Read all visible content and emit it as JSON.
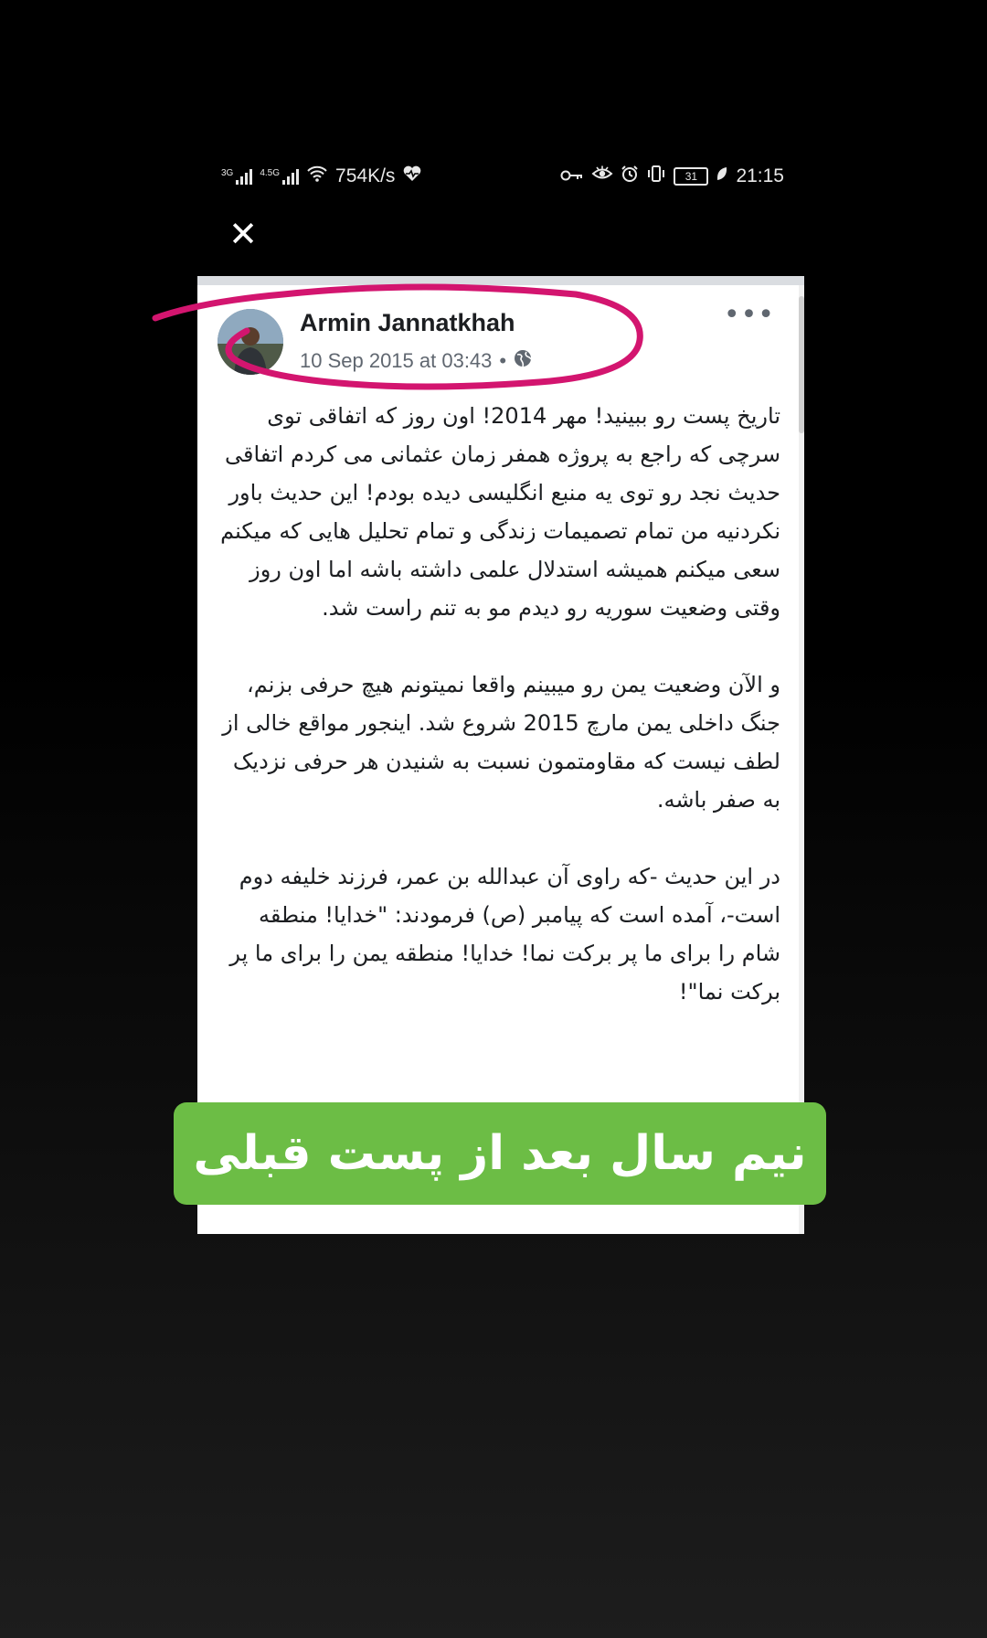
{
  "status_bar": {
    "network_1": "3G",
    "network_2": "4.5G",
    "speed": "754K/s",
    "battery": "31",
    "time": "21:15"
  },
  "icons": {
    "close": "close-icon",
    "more": "more-options-icon",
    "audience": "globe-icon",
    "wifi": "wifi-icon",
    "heart": "heart-rate-icon",
    "key": "key-icon",
    "eye": "eye-icon",
    "alarm": "alarm-icon",
    "vibrate": "vibrate-icon",
    "leaf": "leaf-icon"
  },
  "post": {
    "author": "Armin Jannatkhah",
    "timestamp": "10 Sep 2015 at 03:43",
    "separator": "•",
    "paragraphs": [
      "تاریخ پست رو ببینید! مهر 2014! اون روز که اتفاقی توی سرچی که راجع به پروژه همفر زمان عثمانی می کردم اتفاقی حدیث نجد رو توی یه منبع انگلیسی دیده بودم! این حدیث باور نکردنیه من تمام تصمیمات زندگی و تمام تحلیل هایی که میکنم سعی میکنم همیشه استدلال علمی داشته باشه اما اون روز وقتی وضعیت سوریه رو دیدم مو به تنم راست شد.",
      "و الآن وضعیت یمن رو میبینم واقعا نمیتونم هیچ حرفی بزنم، جنگ داخلی یمن مارچ 2015 شروع شد. اینجور مواقع خالی از لطف نیست که مقاومتمون نسبت به شنیدن هر حرفی نزدیک به صفر باشه.",
      "در این حدیث -که راوی آن عبدالله بن عمر، فرزند خلیفه دوم است-، آمده است که پیامبر (ص) فرمودند: \"خدایا! منطقه شام را برای ما پر برکت نما! خدایا! منطقه یمن را برای ما پر برکت نما\"!"
    ]
  },
  "caption": "نیم سال بعد از پست قبلی",
  "colors": {
    "highlight_stroke": "#d3156f",
    "caption_bg": "#6cbd45"
  }
}
